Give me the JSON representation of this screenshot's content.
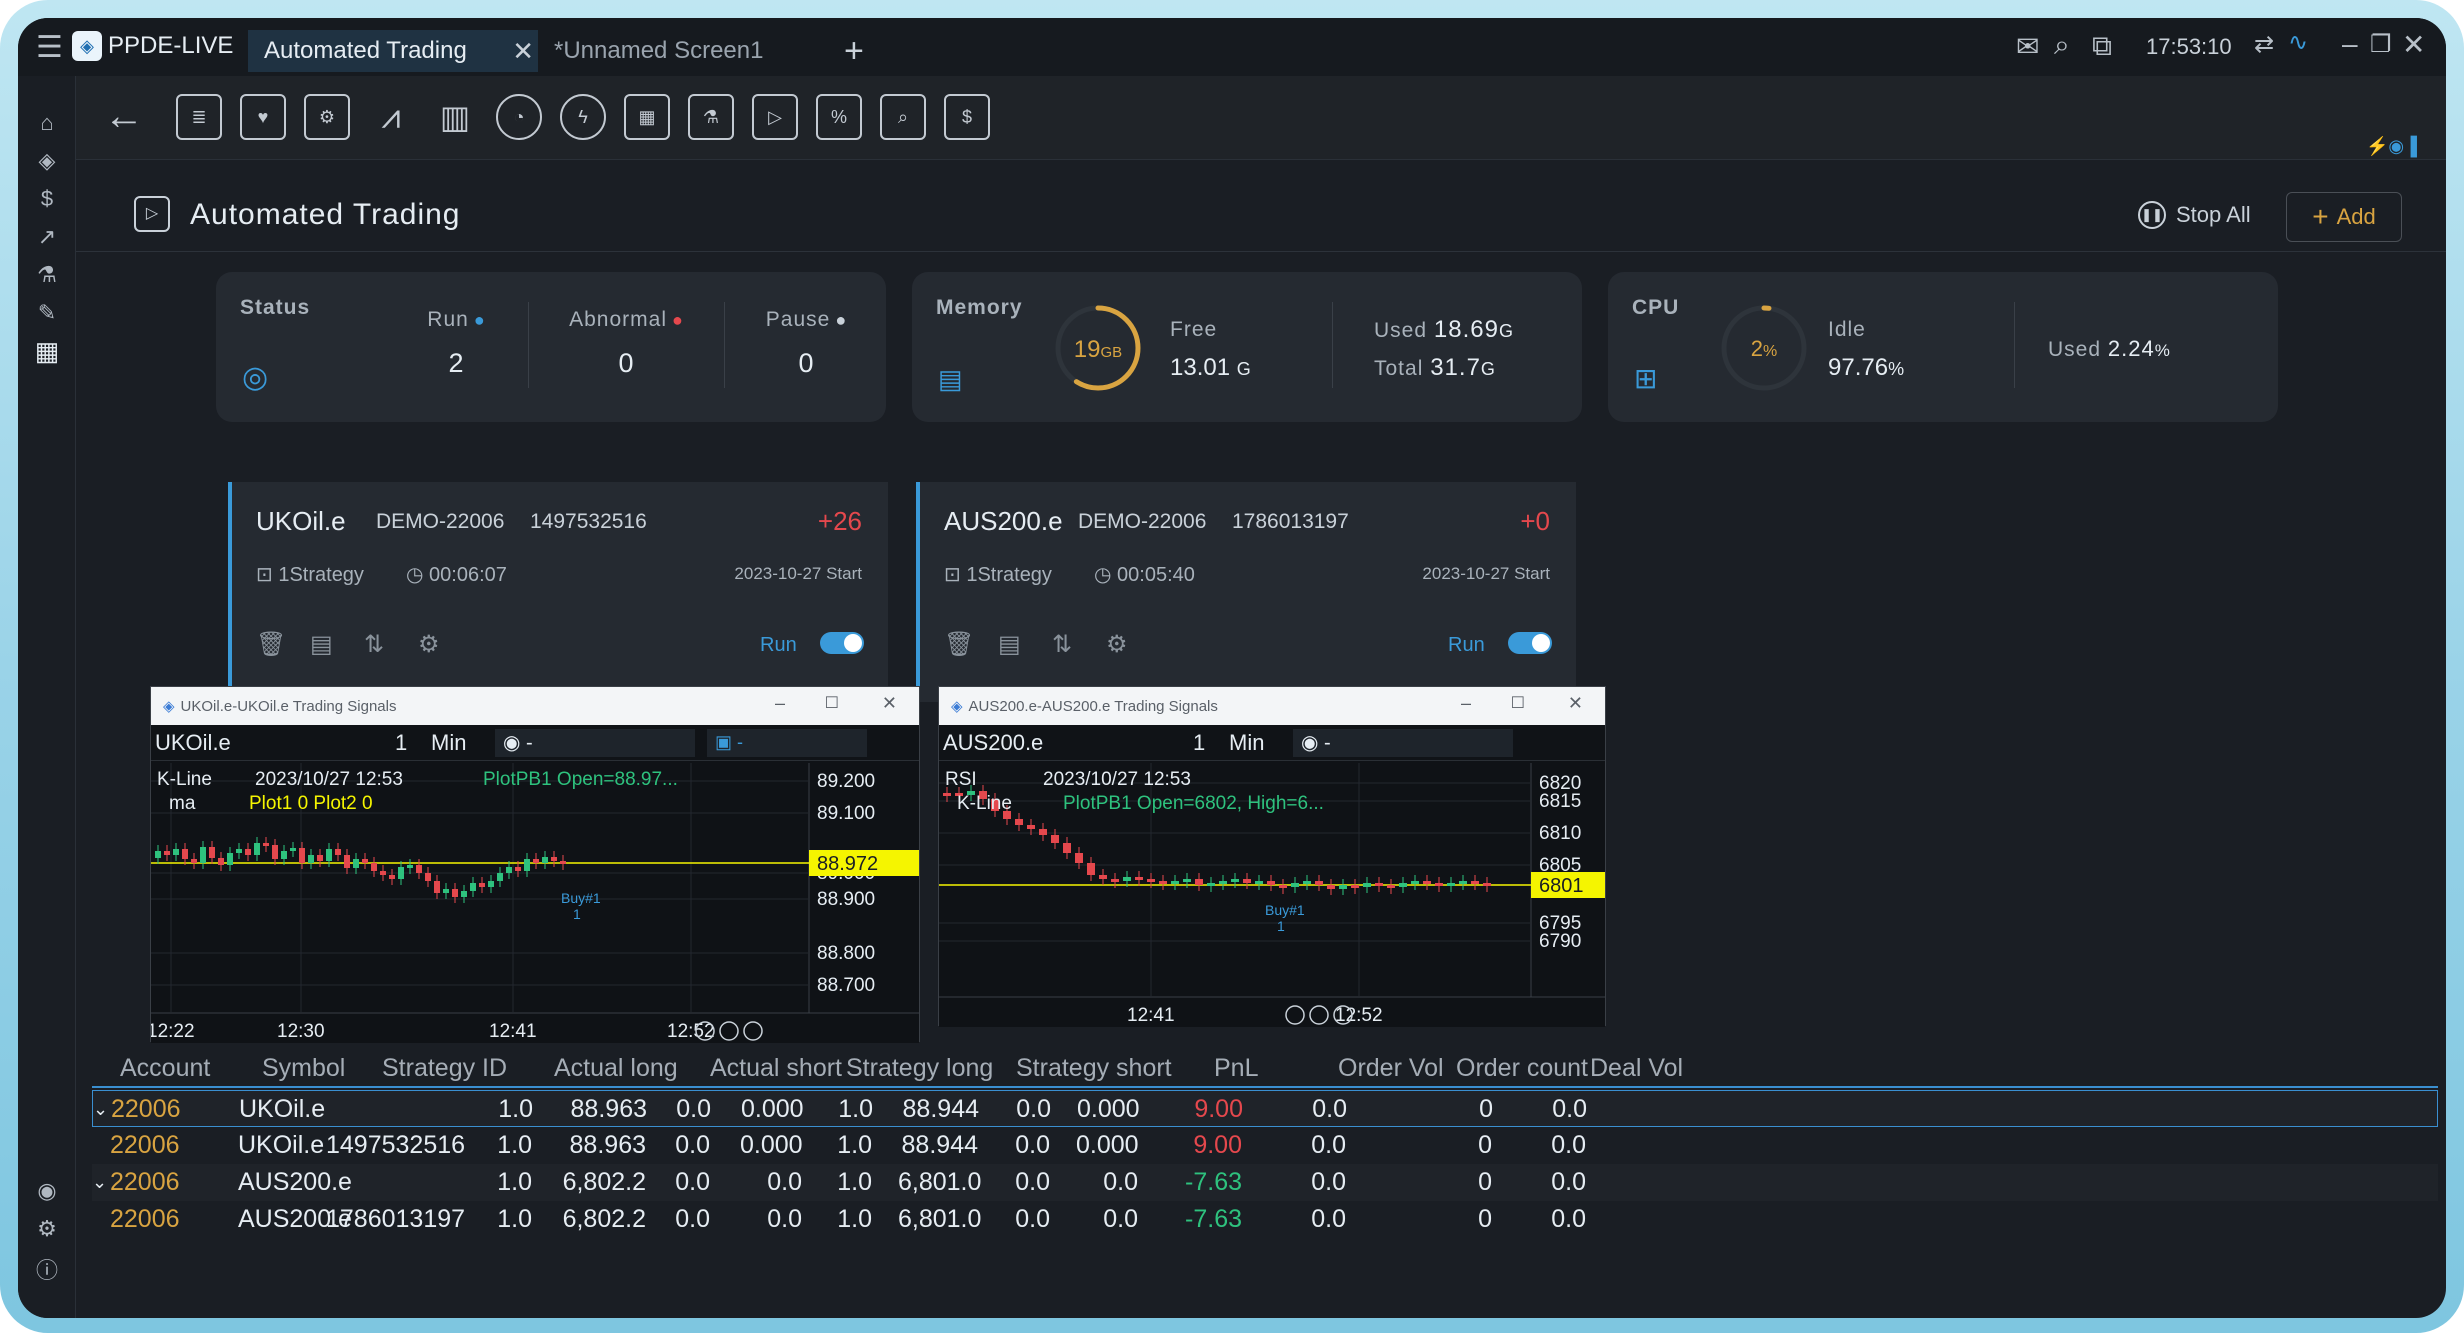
{
  "app": {
    "name": "PPDE-LIVE",
    "clock": "17:53:10"
  },
  "tabs": [
    {
      "label": "Automated Trading",
      "active": true
    },
    {
      "label": "*Unnamed Screen1",
      "active": false
    }
  ],
  "page": {
    "title": "Automated Trading",
    "stop_all": "Stop All",
    "add": "Add"
  },
  "status": {
    "title": "Status",
    "run_label": "Run",
    "run_value": "2",
    "abnormal_label": "Abnormal",
    "abnormal_value": "0",
    "pause_label": "Pause",
    "pause_value": "0"
  },
  "memory": {
    "title": "Memory",
    "gauge_value": "19",
    "gauge_unit": "GB",
    "free_label": "Free",
    "free_value": "13.01",
    "free_unit": "G",
    "used_label": "Used",
    "used_value": "18.69",
    "used_unit": "G",
    "total_label": "Total",
    "total_value": "31.7",
    "total_unit": "G",
    "gauge_fraction": 0.59
  },
  "cpu": {
    "title": "CPU",
    "gauge_value": "2",
    "gauge_unit": "%",
    "idle_label": "Idle",
    "idle_value": "97.76",
    "idle_unit": "%",
    "used_label": "Used",
    "used_value": "2.24",
    "used_unit": "%",
    "gauge_fraction": 0.02
  },
  "strategies": [
    {
      "symbol": "UKOil.e",
      "account": "DEMO-22006",
      "id": "1497532516",
      "pnl": "+26",
      "strategy_count": "1Strategy",
      "elapsed": "00:06:07",
      "start": "2023-10-27 Start",
      "run_label": "Run",
      "on": true
    },
    {
      "symbol": "AUS200.e",
      "account": "DEMO-22006",
      "id": "1786013197",
      "pnl": "+0",
      "strategy_count": "1Strategy",
      "elapsed": "00:05:40",
      "start": "2023-10-27 Start",
      "run_label": "Run",
      "on": true
    }
  ],
  "chart1": {
    "window_title": "UKOil.e-UKOil.e Trading Signals",
    "symbol": "UKOil.e",
    "period_num": "1",
    "period_unit": "Min",
    "legend1": "K-Line",
    "legend1_date": "2023/10/27 12:53",
    "legend1_plot": "PlotPB1 Open=88.97...",
    "legend2": "ma",
    "legend2_plot": "Plot1 0  Plot2 0",
    "last_price": "88.972",
    "last_price2": "88.936",
    "yticks": [
      "89.200",
      "89.100",
      "89.000",
      "88.900",
      "88.800",
      "88.700"
    ],
    "xticks": [
      "12:22",
      "12:30",
      "12:41",
      "12:52"
    ],
    "buy_label": "Buy#1",
    "buy_num": "1"
  },
  "chart2": {
    "window_title": "AUS200.e-AUS200.e Trading Signals",
    "symbol": "AUS200.e",
    "period_num": "1",
    "period_unit": "Min",
    "legend1": "RSI",
    "legend1_date": "2023/10/27 12:53",
    "legend2": "K-Line",
    "legend2_plot": "PlotPB1 Open=6802, High=6...",
    "last_price": "6801",
    "yticks": [
      "6820",
      "6815",
      "6810",
      "6805",
      "6795",
      "6790"
    ],
    "xticks": [
      "12:41",
      "12:52"
    ],
    "buy_label": "Buy#1",
    "buy_num": "1"
  },
  "table": {
    "headers": [
      "Account",
      "Symbol",
      "Strategy ID",
      "Actual long",
      "Actual short",
      "Strategy long",
      "Strategy short",
      "PnL",
      "Order Vol",
      "Order count",
      "Deal Vol"
    ],
    "rows": [
      {
        "expand": true,
        "account": "22006",
        "symbol": "UKOil.e",
        "sid": "",
        "al_q": "1.0",
        "al_p": "88.963",
        "as_q": "0.0",
        "as_p": "0.000",
        "sl_q": "1.0",
        "sl_p": "88.944",
        "ss_q": "0.0",
        "ss_p": "0.000",
        "pnl": "9.00",
        "ovol": "0.0",
        "ocnt": "0",
        "dvol": "0.0"
      },
      {
        "expand": false,
        "account": "22006",
        "symbol": "UKOil.e",
        "sid": "1497532516",
        "al_q": "1.0",
        "al_p": "88.963",
        "as_q": "0.0",
        "as_p": "0.000",
        "sl_q": "1.0",
        "sl_p": "88.944",
        "ss_q": "0.0",
        "ss_p": "0.000",
        "pnl": "9.00",
        "ovol": "0.0",
        "ocnt": "0",
        "dvol": "0.0"
      },
      {
        "expand": true,
        "account": "22006",
        "symbol": "AUS200.e",
        "sid": "",
        "al_q": "1.0",
        "al_p": "6,802.2",
        "as_q": "0.0",
        "as_p": "0.0",
        "sl_q": "1.0",
        "sl_p": "6,801.0",
        "ss_q": "0.0",
        "ss_p": "0.0",
        "pnl": "-7.63",
        "ovol": "0.0",
        "ocnt": "0",
        "dvol": "0.0"
      },
      {
        "expand": false,
        "account": "22006",
        "symbol": "AUS200.e",
        "sid": "1786013197",
        "al_q": "1.0",
        "al_p": "6,802.2",
        "as_q": "0.0",
        "as_p": "0.0",
        "sl_q": "1.0",
        "sl_p": "6,801.0",
        "ss_q": "0.0",
        "ss_p": "0.0",
        "pnl": "-7.63",
        "ovol": "0.0",
        "ocnt": "0",
        "dvol": "0.0"
      }
    ]
  },
  "colors": {
    "accent": "#3a9ad9",
    "up": "#2ec27e",
    "down": "#e5484d",
    "highlight": "#f5f500",
    "run_dot": "#3a9ad9",
    "abnormal_dot": "#e5484d"
  }
}
